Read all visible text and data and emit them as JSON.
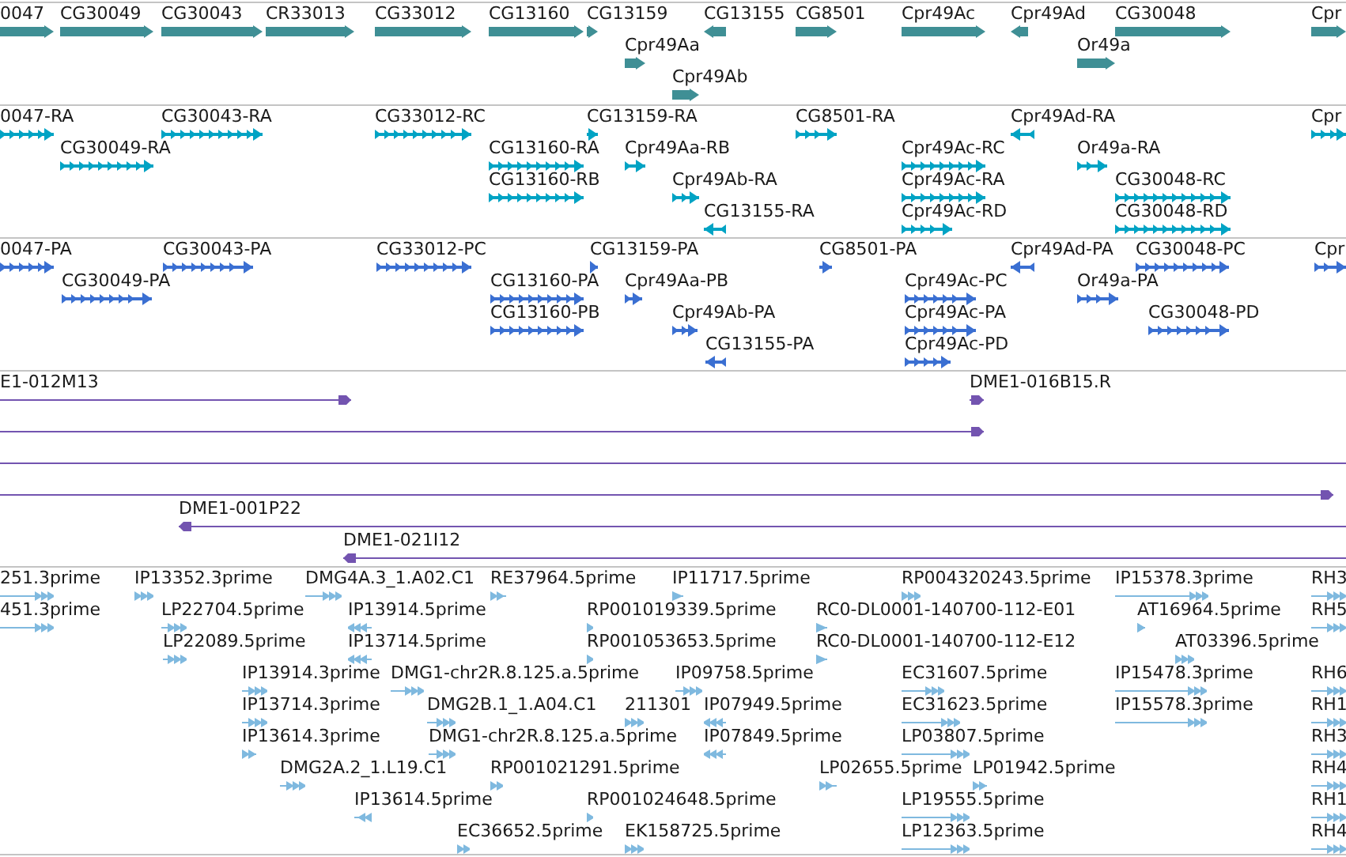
{
  "tracks": [
    {
      "kind": "gene",
      "color": "#3f8f95",
      "features": [
        {
          "label": "0047",
          "reverse": false
        },
        {
          "label": "CG30049",
          "reverse": false
        },
        {
          "label": "CG30043",
          "reverse": false
        },
        {
          "label": "CR33013",
          "reverse": false
        },
        {
          "label": "CG33012",
          "reverse": false
        },
        {
          "label": "CG13160",
          "reverse": false
        },
        {
          "label": "CG13159",
          "reverse": false
        },
        {
          "label": "CG13155",
          "reverse": true
        },
        {
          "label": "CG8501",
          "reverse": false
        },
        {
          "label": "Cpr49Ac",
          "reverse": false
        },
        {
          "label": "Cpr49Ad",
          "reverse": true
        },
        {
          "label": "CG30048",
          "reverse": false
        },
        {
          "label": "Cpr",
          "reverse": false
        },
        {
          "label": "Cpr49Aa",
          "reverse": false
        },
        {
          "label": "Or49a",
          "reverse": false
        },
        {
          "label": "Cpr49Ab",
          "reverse": false
        }
      ]
    },
    {
      "kind": "transcript",
      "color": "#00a3c4",
      "features": [
        {
          "label": "0047-RA",
          "reverse": false
        },
        {
          "label": "CG30043-RA",
          "reverse": false
        },
        {
          "label": "CG33012-RC",
          "reverse": false
        },
        {
          "label": "CG13159-RA",
          "reverse": false
        },
        {
          "label": "CG8501-RA",
          "reverse": false
        },
        {
          "label": "Cpr49Ad-RA",
          "reverse": true
        },
        {
          "label": "Cpr",
          "reverse": false
        },
        {
          "label": "CG30049-RA",
          "reverse": false
        },
        {
          "label": "CG13160-RA",
          "reverse": false
        },
        {
          "label": "Cpr49Aa-RB",
          "reverse": false
        },
        {
          "label": "Cpr49Ac-RC",
          "reverse": false
        },
        {
          "label": "Or49a-RA",
          "reverse": false
        },
        {
          "label": "CG13160-RB",
          "reverse": false
        },
        {
          "label": "Cpr49Ab-RA",
          "reverse": false
        },
        {
          "label": "Cpr49Ac-RA",
          "reverse": false
        },
        {
          "label": "CG30048-RC",
          "reverse": false
        },
        {
          "label": "CG13155-RA",
          "reverse": true
        },
        {
          "label": "Cpr49Ac-RD",
          "reverse": false
        },
        {
          "label": "CG30048-RD",
          "reverse": false
        }
      ]
    },
    {
      "kind": "transcript",
      "color": "#3a6fd2",
      "features": [
        {
          "label": "0047-PA",
          "reverse": false
        },
        {
          "label": "CG30043-PA",
          "reverse": false
        },
        {
          "label": "CG33012-PC",
          "reverse": false
        },
        {
          "label": "CG13159-PA",
          "reverse": false
        },
        {
          "label": "CG8501-PA",
          "reverse": false
        },
        {
          "label": "Cpr49Ad-PA",
          "reverse": true
        },
        {
          "label": "CG30048-PC",
          "reverse": false
        },
        {
          "label": "Cpr",
          "reverse": false
        },
        {
          "label": "CG30049-PA",
          "reverse": false
        },
        {
          "label": "CG13160-PA",
          "reverse": false
        },
        {
          "label": "Cpr49Aa-PB",
          "reverse": false
        },
        {
          "label": "Cpr49Ac-PC",
          "reverse": false
        },
        {
          "label": "Or49a-PA",
          "reverse": false
        },
        {
          "label": "CG13160-PB",
          "reverse": false
        },
        {
          "label": "Cpr49Ab-PA",
          "reverse": false
        },
        {
          "label": "Cpr49Ac-PA",
          "reverse": false
        },
        {
          "label": "CG30048-PD",
          "reverse": false
        },
        {
          "label": "CG13155-PA",
          "reverse": true
        },
        {
          "label": "Cpr49Ac-PD",
          "reverse": false
        }
      ]
    },
    {
      "kind": "clone",
      "color": "#7354b0",
      "features": [
        {
          "label": "E1-012M13",
          "reverse": false,
          "arrowhead": true
        },
        {
          "label": "DME1-016B15.R",
          "reverse": false,
          "arrowhead": true
        },
        {
          "reverse": false,
          "arrowhead": true
        },
        {
          "arrowhead": false
        },
        {
          "reverse": false,
          "arrowhead": true
        },
        {
          "label": "DME1-001P22",
          "reverse": true,
          "arrowhead": true
        },
        {
          "label": "DME1-021I12",
          "reverse": true,
          "arrowhead": true
        }
      ]
    },
    {
      "kind": "est",
      "color": "#7fb9df",
      "features": [
        {
          "label": "251.3prime",
          "reverse": false
        },
        {
          "label": "IP13352.3prime",
          "reverse": false
        },
        {
          "label": "DMG4A.3_1.A02.C1",
          "reverse": false
        },
        {
          "label": "RE37964.5prime",
          "reverse": false
        },
        {
          "label": "IP11717.5prime",
          "reverse": false
        },
        {
          "label": "RP004320243.5prime",
          "reverse": false
        },
        {
          "label": "IP15378.3prime",
          "reverse": false
        },
        {
          "label": "RH3",
          "reverse": false
        },
        {
          "label": "451.3prime",
          "reverse": false
        },
        {
          "label": "LP22704.5prime",
          "reverse": false
        },
        {
          "label": "IP13914.5prime",
          "reverse": true
        },
        {
          "label": "RP001019339.5prime",
          "reverse": false
        },
        {
          "label": "RC0-DL0001-140700-112-E01",
          "reverse": false
        },
        {
          "label": "AT16964.5prime",
          "reverse": false
        },
        {
          "label": "RH5",
          "reverse": false
        },
        {
          "label": "LP22089.5prime",
          "reverse": false
        },
        {
          "label": "IP13714.5prime",
          "reverse": true
        },
        {
          "label": "RP001053653.5prime",
          "reverse": false
        },
        {
          "label": "RC0-DL0001-140700-112-E12",
          "reverse": false
        },
        {
          "label": "AT03396.5prime",
          "reverse": false
        },
        {
          "label": "IP13914.3prime",
          "reverse": false
        },
        {
          "label": "DMG1-chr2R.8.125.a.5prime",
          "reverse": false
        },
        {
          "label": "IP09758.5prime",
          "reverse": false
        },
        {
          "label": "EC31607.5prime",
          "reverse": false
        },
        {
          "label": "IP15478.3prime",
          "reverse": false
        },
        {
          "label": "RH6",
          "reverse": false
        },
        {
          "label": "IP13714.3prime",
          "reverse": false
        },
        {
          "label": "DMG2B.1_1.A04.C1",
          "reverse": false
        },
        {
          "label": "211301",
          "reverse": false
        },
        {
          "label": "IP07949.5prime",
          "reverse": true
        },
        {
          "label": "EC31623.5prime",
          "reverse": false
        },
        {
          "label": "IP15578.3prime",
          "reverse": false
        },
        {
          "label": "RH1",
          "reverse": false
        },
        {
          "label": "IP13614.3prime",
          "reverse": false
        },
        {
          "label": "DMG1-chr2R.8.125.a.5prime",
          "reverse": false
        },
        {
          "label": "IP07849.5prime",
          "reverse": true
        },
        {
          "label": "LP03807.5prime",
          "reverse": false
        },
        {
          "label": "RH3",
          "reverse": false
        },
        {
          "label": "DMG2A.2_1.L19.C1",
          "reverse": false
        },
        {
          "label": "RP001021291.5prime",
          "reverse": false
        },
        {
          "label": "LP02655.5prime",
          "reverse": false
        },
        {
          "label": "LP01942.5prime",
          "reverse": false
        },
        {
          "label": "RH4",
          "reverse": false
        },
        {
          "label": "IP13614.5prime",
          "reverse": true
        },
        {
          "label": "RP001024648.5prime",
          "reverse": false
        },
        {
          "label": "LP19555.5prime",
          "reverse": false
        },
        {
          "label": "RH1",
          "reverse": false
        },
        {
          "label": "EC36652.5prime",
          "reverse": false
        },
        {
          "label": "EK158725.5prime",
          "reverse": false
        },
        {
          "label": "LP12363.5prime",
          "reverse": false
        },
        {
          "label": "RH4",
          "reverse": false
        }
      ]
    }
  ]
}
